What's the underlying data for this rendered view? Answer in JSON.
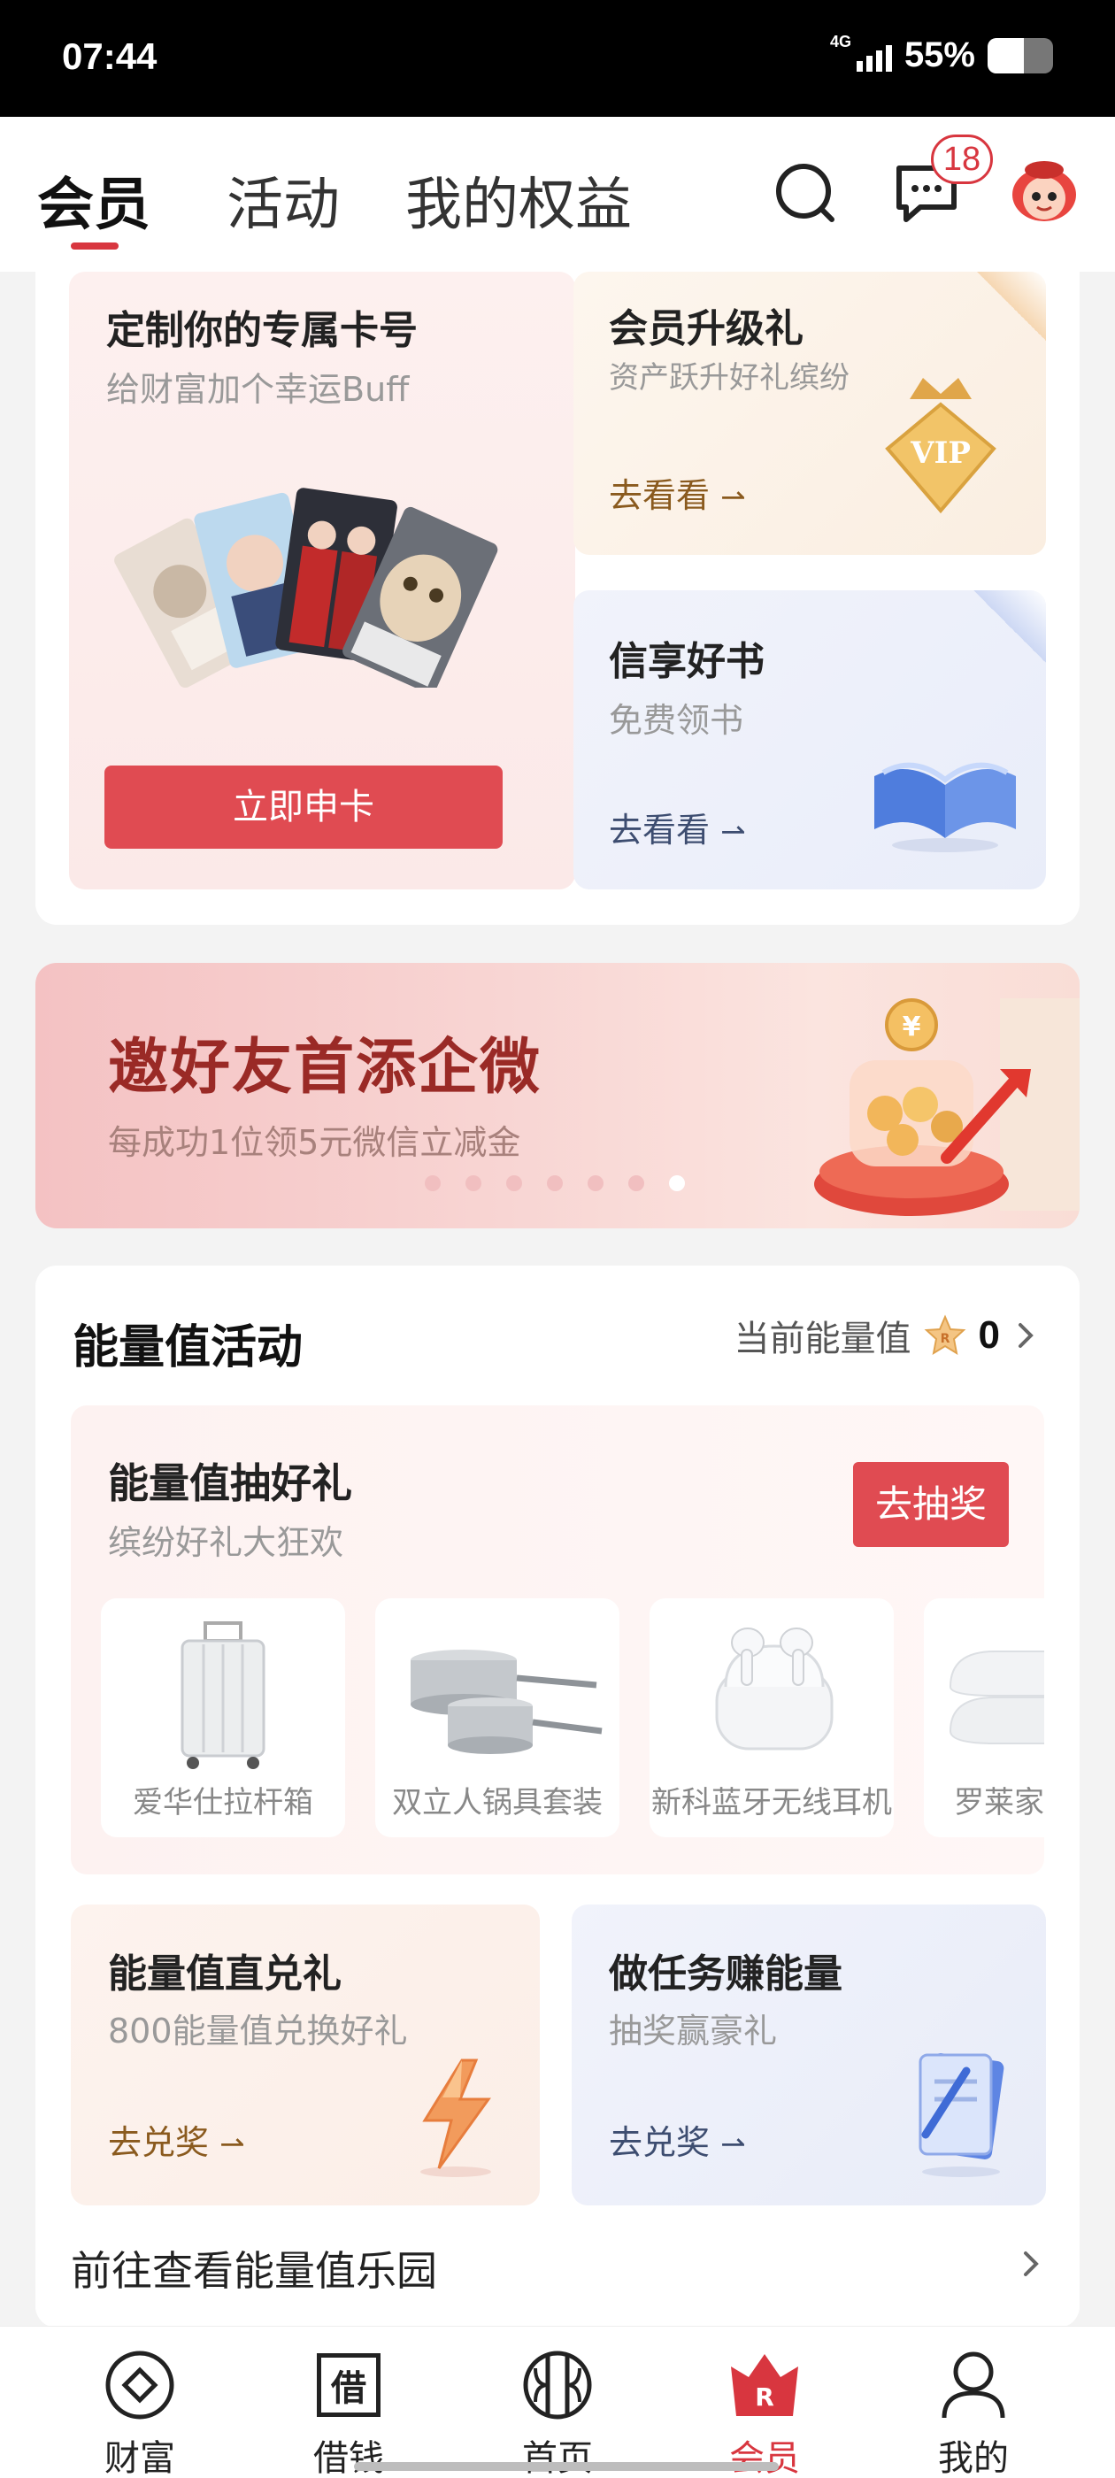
{
  "status": {
    "time": "07:44",
    "network": "4G",
    "battery": "55%",
    "battery_level": 0.55
  },
  "header": {
    "tabs": [
      {
        "label": "会员",
        "active": true
      },
      {
        "label": "活动",
        "active": false
      },
      {
        "label": "我的权益",
        "active": false
      }
    ],
    "message_badge": "18",
    "icons": [
      "search-icon",
      "message-icon",
      "mascot-avatar"
    ]
  },
  "cards": {
    "custom_card": {
      "title": "定制你的专属卡号",
      "subtitle": "给财富加个幸运Buff",
      "button": "立即申卡"
    },
    "upgrade": {
      "title": "会员升级礼",
      "subtitle": "资产跃升好礼缤纷",
      "link": "去看看",
      "icon": "vip-diamond-icon"
    },
    "books": {
      "title": "信享好书",
      "subtitle": "免费领书",
      "link": "去看看",
      "icon": "open-book-icon"
    }
  },
  "banner": {
    "title": "邀好友首添企微",
    "subtitle": "每成功1位领5元微信立减金",
    "page_count": 7,
    "active_page": 7
  },
  "energy": {
    "title": "能量值活动",
    "current_label": "当前能量值",
    "current_value": "0",
    "lottery": {
      "title": "能量值抽好礼",
      "subtitle": "缤纷好礼大狂欢",
      "button": "去抽奖",
      "prizes": [
        {
          "name": "爱华仕拉杆箱",
          "icon": "suitcase-icon"
        },
        {
          "name": "双立人锅具套装",
          "icon": "cookware-icon"
        },
        {
          "name": "新科蓝牙无线耳机",
          "icon": "earbuds-icon"
        },
        {
          "name": "罗莱家",
          "icon": "pillow-icon"
        }
      ]
    },
    "exchange": {
      "title": "能量值直兑礼",
      "subtitle": "800能量值兑换好礼",
      "link": "去兑奖",
      "icon": "lightning-icon"
    },
    "tasks": {
      "title": "做任务赚能量",
      "subtitle": "抽奖赢豪礼",
      "link": "去兑奖",
      "icon": "document-pen-icon"
    },
    "park_link": "前往查看能量值乐园"
  },
  "bottom_nav": [
    {
      "label": "财富",
      "icon": "wealth-icon",
      "active": false
    },
    {
      "label": "借钱",
      "icon": "borrow-icon",
      "active": false,
      "icon_text": "借"
    },
    {
      "label": "首页",
      "icon": "home-logo-icon",
      "active": false
    },
    {
      "label": "会员",
      "icon": "member-crown-icon",
      "active": true,
      "icon_text": "R"
    },
    {
      "label": "我的",
      "icon": "profile-icon",
      "active": false
    }
  ],
  "colors": {
    "accent": "#d8363f",
    "button_red": "#e04b52",
    "gold_link": "#8a5a1e",
    "blue_link": "#3d4d70"
  }
}
